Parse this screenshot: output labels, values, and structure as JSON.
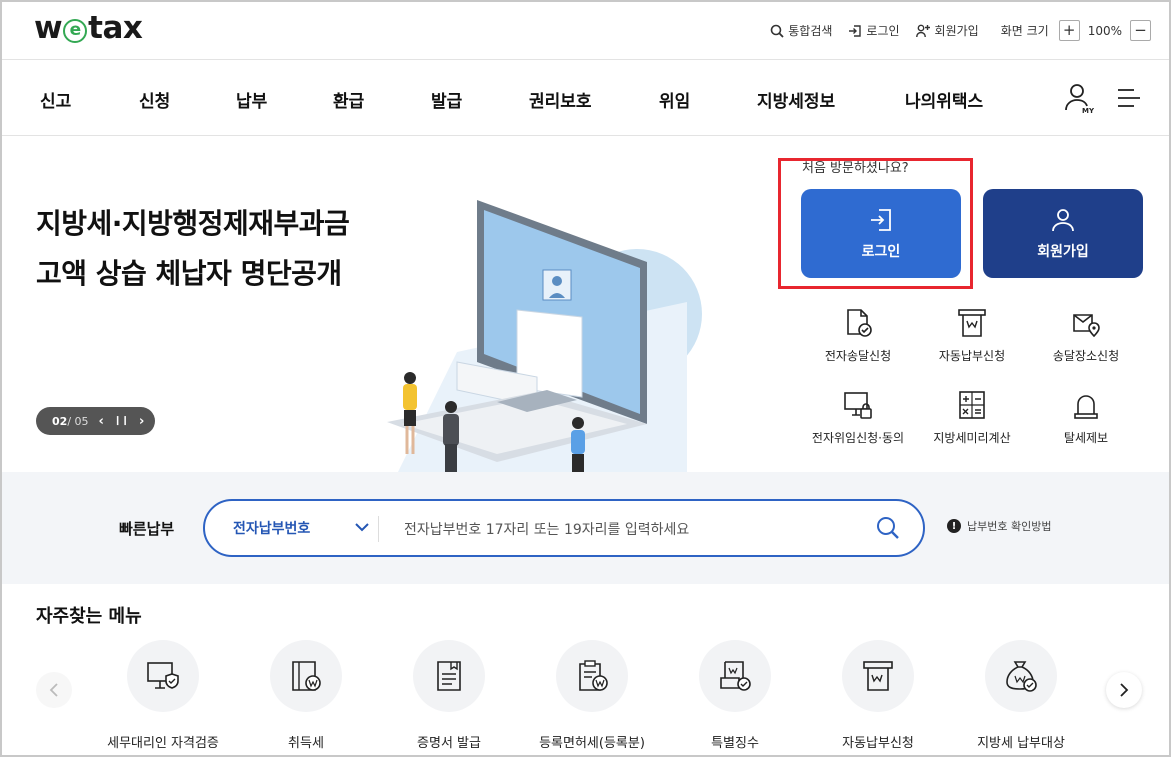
{
  "header": {
    "logo_text_pre": "w",
    "logo_text_e": "e",
    "logo_text_post": "tax",
    "util": {
      "search": "통합검색",
      "login": "로그인",
      "join": "회원가입",
      "zoom_label": "화면 크기",
      "zoom_plus": "+",
      "zoom_value": "100%",
      "zoom_minus": "−"
    }
  },
  "gnb": {
    "items": [
      "신고",
      "신청",
      "납부",
      "환급",
      "발급",
      "권리보호",
      "위임",
      "지방세정보",
      "나의위택스"
    ],
    "my_label": "MY"
  },
  "hero": {
    "title_line1": "지방세·지방행정제재부과금",
    "title_line2": "고액 상습 체납자 명단공개",
    "pager_current": "02",
    "pager_total": "/ 05",
    "pager_prev": "‹",
    "pager_pause": "❙❙",
    "pager_next": "›"
  },
  "member": {
    "visit_text": "처음 방문하셨나요?",
    "login_label": "로그인",
    "join_label": "회원가입"
  },
  "services": [
    {
      "label": "전자송달신청",
      "icon": "document-check-icon"
    },
    {
      "label": "자동납부신청",
      "icon": "auto-pay-icon"
    },
    {
      "label": "송달장소신청",
      "icon": "location-mail-icon"
    },
    {
      "label": "전자위임신청·동의",
      "icon": "monitor-lock-icon"
    },
    {
      "label": "지방세미리계산",
      "icon": "calculator-icon"
    },
    {
      "label": "탈세제보",
      "icon": "alarm-bell-icon"
    }
  ],
  "quick_pay": {
    "label": "빠른납부",
    "select_value": "전자납부번호",
    "placeholder": "전자납부번호 17자리 또는 19자리를 입력하세요",
    "help_mark": "!",
    "help_text": "납부번호 확인방법"
  },
  "frequent": {
    "title": "자주찾는 메뉴",
    "items": [
      {
        "label": "세무대리인 자격검증",
        "icon": "monitor-shield-icon"
      },
      {
        "label": "취득세",
        "icon": "building-won-icon"
      },
      {
        "label": "증명서 발급",
        "icon": "certificate-icon"
      },
      {
        "label": "등록면허세(등록분)",
        "icon": "clipboard-won-icon"
      },
      {
        "label": "특별징수",
        "icon": "document-won-check-icon"
      },
      {
        "label": "자동납부신청",
        "icon": "auto-pay-icon"
      },
      {
        "label": "지방세 납부대상",
        "icon": "money-bag-check-icon"
      }
    ]
  },
  "colors": {
    "primary_blue": "#2f6bd1",
    "navy": "#1f3f8a",
    "highlight_red": "#e8262f",
    "logo_green": "#33a853"
  }
}
